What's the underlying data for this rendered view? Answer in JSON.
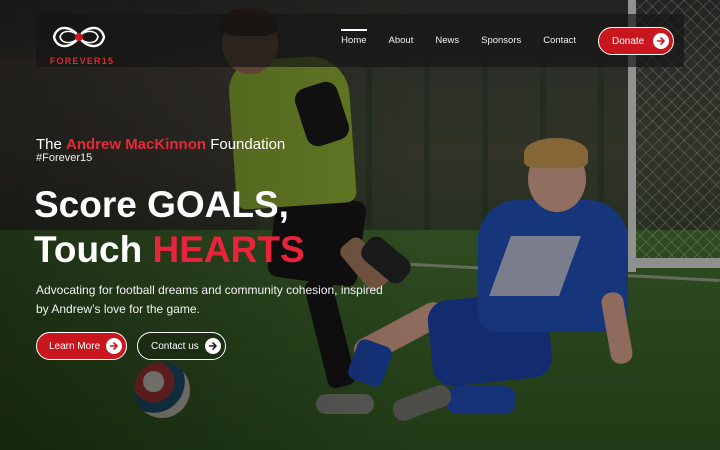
{
  "brand": {
    "logo_text": "FOREVER15",
    "accent": "#c9151d"
  },
  "nav": {
    "items": [
      {
        "label": "Home",
        "active": true
      },
      {
        "label": "About"
      },
      {
        "label": "News"
      },
      {
        "label": "Sponsors"
      },
      {
        "label": "Contact"
      }
    ],
    "donate_label": "Donate"
  },
  "hero": {
    "tagline_prefix": "The ",
    "tagline_name": "Andrew MacKinnon",
    "tagline_suffix": " Foundation",
    "hashtag": "#Forever15",
    "headline_line1": "Score GOALS,",
    "headline_line2_prefix": "Touch ",
    "headline_line2_highlight": "HEARTS",
    "description": "Advocating for football dreams and community cohesion, inspired by Andrew’s love for the game.",
    "cta_primary": "Learn More",
    "cta_secondary": "Contact us"
  },
  "icons": {
    "arrow": "arrow-right-icon",
    "logo": "infinity-15-logo-icon"
  }
}
